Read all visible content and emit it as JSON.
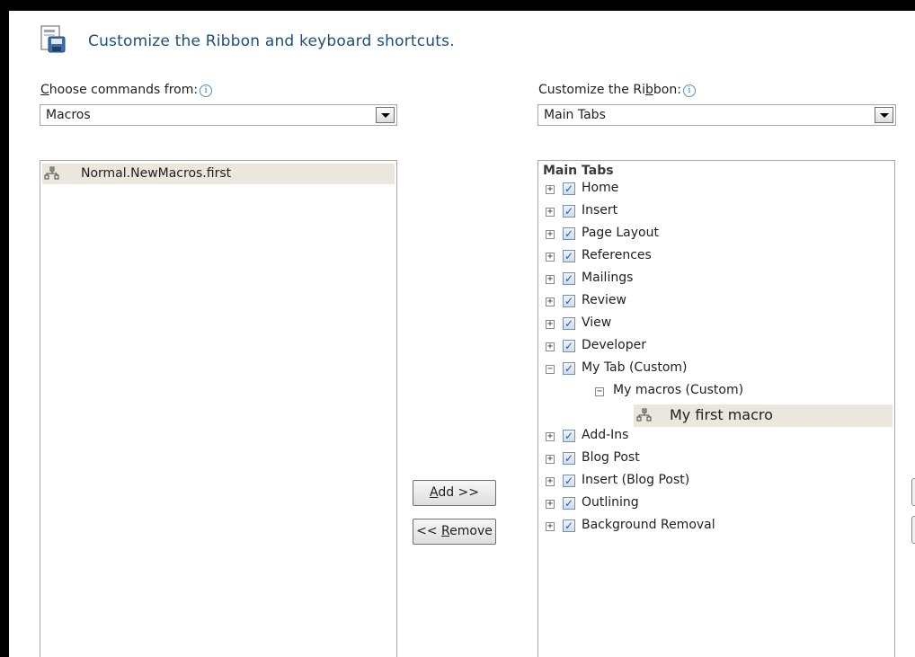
{
  "header": {
    "title": "Customize the Ribbon and keyboard shortcuts.",
    "icon": "customize-dialog-icon"
  },
  "left": {
    "label_prefix": "C",
    "label_rest": "hoose commands from:",
    "info": "i",
    "combo_value": "Macros",
    "items": [
      {
        "label": "Normal.NewMacros.first",
        "icon": "macro-icon"
      }
    ]
  },
  "right": {
    "label_pre": "Customize the Ri",
    "label_u": "b",
    "label_post": "bon:",
    "info": "i",
    "combo_value": "Main Tabs",
    "tree_header": "Main Tabs",
    "tabs_before": [
      {
        "label": "Home"
      },
      {
        "label": "Insert"
      },
      {
        "label": "Page Layout"
      },
      {
        "label": "References"
      },
      {
        "label": "Mailings"
      },
      {
        "label": "Review"
      },
      {
        "label": "View"
      },
      {
        "label": "Developer"
      }
    ],
    "custom_tab": {
      "label": "My Tab (Custom)",
      "expanded": true,
      "checked": true
    },
    "custom_group": {
      "label": "My macros (Custom)",
      "expanded": true
    },
    "custom_command": {
      "label": "My first macro",
      "icon": "macro-icon"
    },
    "tabs_after": [
      {
        "label": "Add-Ins"
      },
      {
        "label": "Blog Post"
      },
      {
        "label": "Insert (Blog Post)"
      },
      {
        "label": "Outlining"
      },
      {
        "label": "Background Removal"
      }
    ]
  },
  "buttons": {
    "add_u": "A",
    "add_rest": "dd >>",
    "remove_pre": "<< ",
    "remove_u": "R",
    "remove_rest": "emove"
  },
  "glyphs": {
    "plus": "+",
    "minus": "−",
    "check": "✓"
  }
}
